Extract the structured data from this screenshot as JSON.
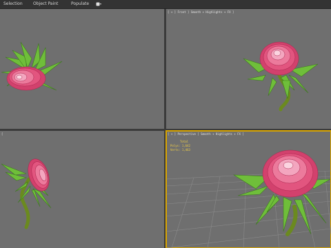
{
  "toolbar": {
    "items": [
      "Selection",
      "Object Paint",
      "Populate"
    ],
    "dropdown_icon": "camera-dropdown-icon"
  },
  "viewports": [
    {
      "name": "top-left",
      "label": ""
    },
    {
      "name": "top-right",
      "label": "[ + ] Front ] Smooth + Highlights + FX ]"
    },
    {
      "name": "bottom-left",
      "label": "["
    },
    {
      "name": "bottom-right",
      "label": "[ + ] Perspective ] Smooth + Highlights + FX ]"
    }
  ],
  "stats": {
    "heading": "Total",
    "polys": "Polys: 1,642",
    "verts": "Verts: 1,463"
  },
  "colors": {
    "viewport_bg": "#6f6f6f",
    "active_border": "#d9a500",
    "petal": "#e2557f",
    "leaf": "#6fbe3a",
    "stem": "#6b8a1f"
  }
}
